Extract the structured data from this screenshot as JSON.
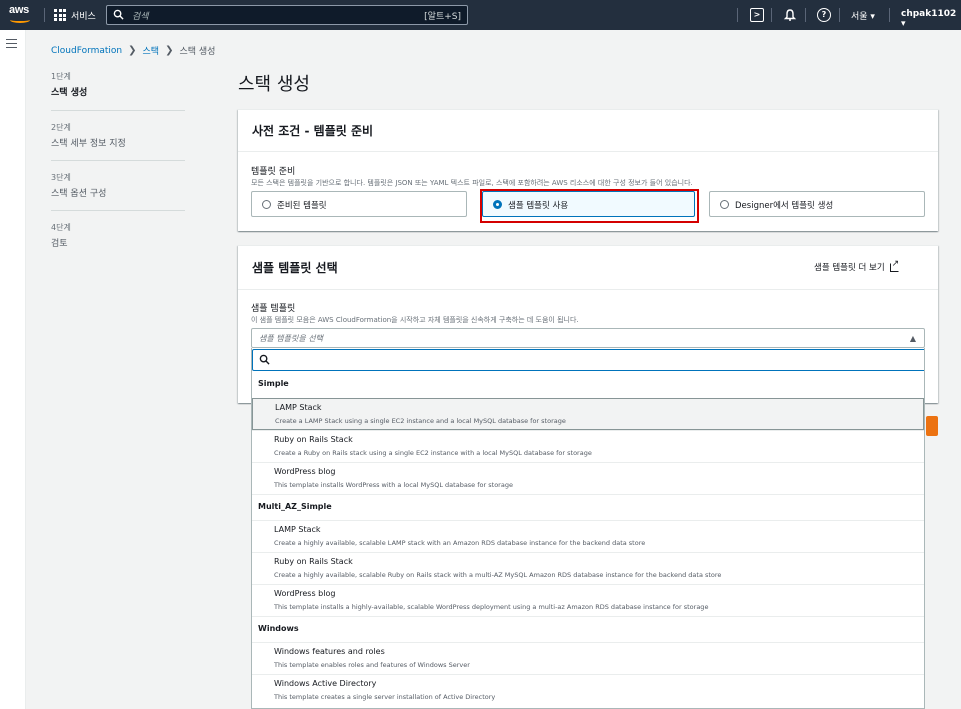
{
  "topnav": {
    "logo": "aws",
    "services": "서비스",
    "search_placeholder": "검색",
    "search_shortcut": "[알트+S]",
    "region": "서울 ▾",
    "account": "chpak1102 ▾",
    "colors": {
      "bg": "#232f3e",
      "accent": "#ff9900"
    }
  },
  "breadcrumb": {
    "item1": "CloudFormation",
    "item2": "스택",
    "current": "스택 생성"
  },
  "steps": [
    {
      "num": "1단계",
      "label": "스택 생성"
    },
    {
      "num": "2단계",
      "label": "스택 세부 정보 지정"
    },
    {
      "num": "3단계",
      "label": "스택 옵션 구성"
    },
    {
      "num": "4단계",
      "label": "검토"
    }
  ],
  "page_title": "스택 생성",
  "prereq": {
    "title": "사전 조건 - 템플릿 준비",
    "field_label": "템플릿 준비",
    "field_desc": "모든 스택은 템플릿을 기반으로 합니다. 템플릿은 JSON 또는 YAML 텍스트 파일로, 스택에 포함하려는 AWS 리소스에 대한 구성 정보가 들어 있습니다.",
    "options": [
      "준비된 템플릿",
      "샘플 템플릿 사용",
      "Designer에서 템플릿 생성"
    ],
    "selected": "샘플 템플릿 사용"
  },
  "sample": {
    "title": "샘플 템플릿 선택",
    "more_link": "샘플 템플릿 더 보기",
    "field_label": "샘플 템플릿",
    "field_desc": "이 샘플 템플릿 모음은 AWS CloudFormation을 시작하고 자체 템플릿을 신속하게 구축하는 데 도움이 됩니다.",
    "placeholder": "샘플 템플릿을 선택",
    "caret": "▲"
  },
  "dropdown": {
    "groups": [
      {
        "name": "Simple",
        "items": [
          {
            "title": "LAMP Stack",
            "desc": "Create a LAMP Stack using a single EC2 instance and a local MySQL database for storage"
          },
          {
            "title": "Ruby on Rails Stack",
            "desc": "Create a Ruby on Rails stack using a single EC2 instance with a local MySQL database for storage"
          },
          {
            "title": "WordPress blog",
            "desc": "This template installs WordPress with a local MySQL database for storage"
          }
        ]
      },
      {
        "name": "Multi_AZ_Simple",
        "items": [
          {
            "title": "LAMP Stack",
            "desc": "Create a highly available, scalable LAMP stack with an Amazon RDS database instance for the backend data store"
          },
          {
            "title": "Ruby on Rails Stack",
            "desc": "Create a highly available, scalable Ruby on Rails stack with a multi-AZ MySQL Amazon RDS database instance for the backend data store"
          },
          {
            "title": "WordPress blog",
            "desc": "This template installs a highly-available, scalable WordPress deployment using a multi-az Amazon RDS database instance for storage"
          }
        ]
      },
      {
        "name": "Windows",
        "items": [
          {
            "title": "Windows features and roles",
            "desc": "This template enables roles and features of Windows Server"
          },
          {
            "title": "Windows Active Directory",
            "desc": "This template creates a single server installation of Active Directory"
          }
        ]
      }
    ]
  }
}
